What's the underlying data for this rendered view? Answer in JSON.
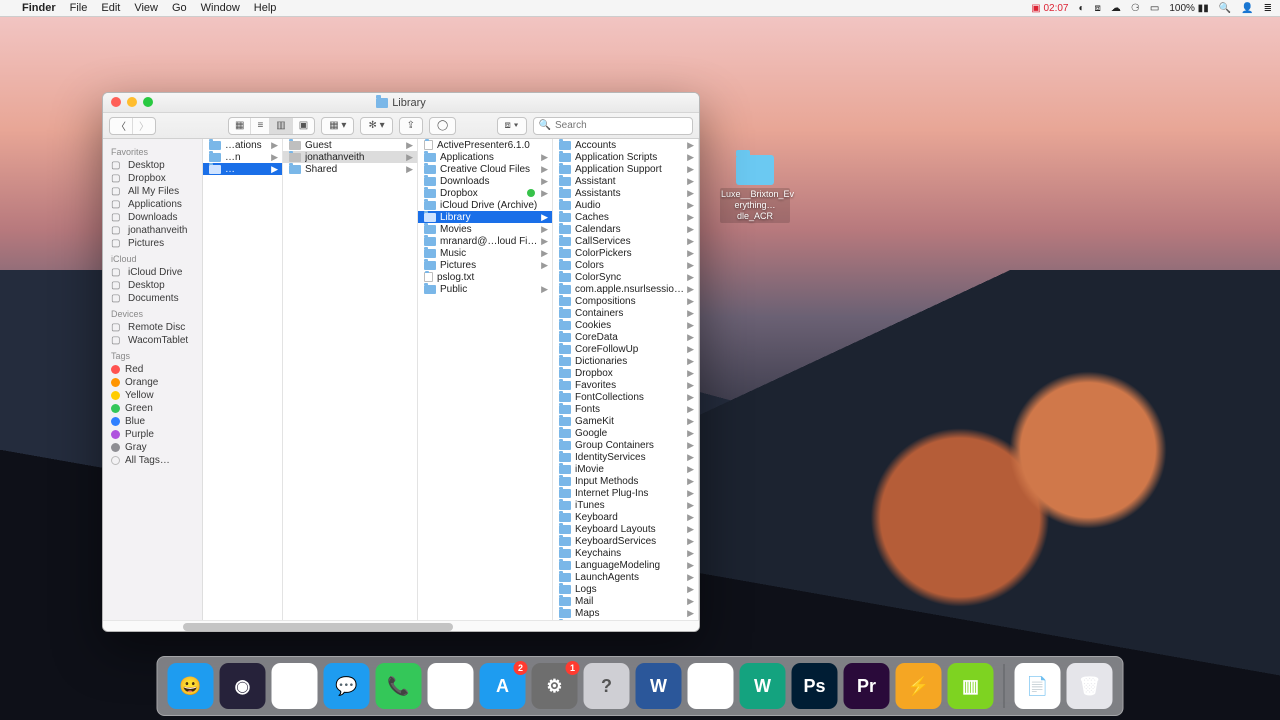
{
  "menubar": {
    "app": "Finder",
    "items": [
      "File",
      "Edit",
      "View",
      "Go",
      "Window",
      "Help"
    ],
    "rec": "02:07",
    "battery": "100%"
  },
  "desktop_icon": {
    "line1": "Luxe__Brixton_Ev",
    "line2": "erything…dle_ACR"
  },
  "window": {
    "title": "Library",
    "search_placeholder": "Search",
    "sidebar": {
      "favorites_head": "Favorites",
      "favorites": [
        "Desktop",
        "Dropbox",
        "All My Files",
        "Applications",
        "Downloads",
        "jonathanveith",
        "Pictures"
      ],
      "icloud_head": "iCloud",
      "icloud": [
        "iCloud Drive",
        "Desktop",
        "Documents"
      ],
      "devices_head": "Devices",
      "devices": [
        "Remote Disc",
        "WacomTablet"
      ],
      "tags_head": "Tags",
      "tags": [
        {
          "label": "Red",
          "c": "#ff5350"
        },
        {
          "label": "Orange",
          "c": "#ff9500"
        },
        {
          "label": "Yellow",
          "c": "#ffcc00"
        },
        {
          "label": "Green",
          "c": "#34c759"
        },
        {
          "label": "Blue",
          "c": "#2f80ff"
        },
        {
          "label": "Purple",
          "c": "#af52de"
        },
        {
          "label": "Gray",
          "c": "#8e8e93"
        },
        {
          "label": "All Tags…",
          "c": ""
        }
      ]
    },
    "col0": [
      {
        "n": "…ations",
        "arr": true
      },
      {
        "n": "…n",
        "arr": true
      },
      {
        "n": "…",
        "arr": true,
        "sel": true
      }
    ],
    "col1": [
      {
        "n": "Guest",
        "arr": true,
        "icon": "home"
      },
      {
        "n": "jonathanveith",
        "arr": true,
        "sel": "gray",
        "icon": "home"
      },
      {
        "n": "Shared",
        "arr": true
      }
    ],
    "col2": [
      {
        "n": "ActivePresenter6.1.0",
        "icon": "file"
      },
      {
        "n": "Applications",
        "arr": true
      },
      {
        "n": "Creative Cloud Files",
        "arr": true
      },
      {
        "n": "Downloads",
        "arr": true
      },
      {
        "n": "Dropbox",
        "arr": true,
        "green": true
      },
      {
        "n": "iCloud Drive (Archive)"
      },
      {
        "n": "Library",
        "arr": true,
        "sel": true
      },
      {
        "n": "Movies",
        "arr": true
      },
      {
        "n": "mranard@…loud Files",
        "arr": true
      },
      {
        "n": "Music",
        "arr": true
      },
      {
        "n": "Pictures",
        "arr": true
      },
      {
        "n": "pslog.txt",
        "icon": "file"
      },
      {
        "n": "Public",
        "arr": true
      }
    ],
    "col3": [
      "Accounts",
      "Application Scripts",
      "Application Support",
      "Assistant",
      "Assistants",
      "Audio",
      "Caches",
      "Calendars",
      "CallServices",
      "ColorPickers",
      "Colors",
      "ColorSync",
      "com.apple.nsurlsessiond",
      "Compositions",
      "Containers",
      "Cookies",
      "CoreData",
      "CoreFollowUp",
      "Dictionaries",
      "Dropbox",
      "Favorites",
      "FontCollections",
      "Fonts",
      "GameKit",
      "Google",
      "Group Containers",
      "IdentityServices",
      "iMovie",
      "Input Methods",
      "Internet Plug-Ins",
      "iTunes",
      "Keyboard",
      "Keyboard Layouts",
      "KeyboardServices",
      "Keychains",
      "LanguageModeling",
      "LaunchAgents",
      "Logs",
      "Mail",
      "Maps",
      "Messages"
    ]
  },
  "dock": {
    "apps": [
      {
        "n": "finder",
        "c": "#1e9cf0",
        "t": "😀"
      },
      {
        "n": "siri",
        "c": "#26223a",
        "t": "◉"
      },
      {
        "n": "photos",
        "c": "#ffffff",
        "t": "✿"
      },
      {
        "n": "messages",
        "c": "#1e9cf0",
        "t": "💬"
      },
      {
        "n": "facetime",
        "c": "#34c759",
        "t": "📞"
      },
      {
        "n": "itunes",
        "c": "#ffffff",
        "t": "♫"
      },
      {
        "n": "appstore",
        "c": "#1e9cf0",
        "t": "A",
        "badge": "2"
      },
      {
        "n": "settings",
        "c": "#6e6e6e",
        "t": "⚙",
        "badge": "1"
      },
      {
        "n": "help",
        "c": "#cfcfd4",
        "t": "?",
        "dark": true
      },
      {
        "n": "word",
        "c": "#2b579a",
        "t": "W"
      },
      {
        "n": "chrome",
        "c": "#ffffff",
        "t": "◯"
      },
      {
        "n": "wire",
        "c": "#14a37f",
        "t": "W"
      },
      {
        "n": "photoshop",
        "c": "#001d34",
        "t": "Ps"
      },
      {
        "n": "premiere",
        "c": "#2a0a3a",
        "t": "Pr"
      },
      {
        "n": "cyberduck",
        "c": "#f5a623",
        "t": "⚡"
      },
      {
        "n": "archive",
        "c": "#7ed321",
        "t": "▥"
      }
    ],
    "right": [
      {
        "n": "doc",
        "c": "#ffffff",
        "t": "📄"
      },
      {
        "n": "trash",
        "c": "#e5e5ea",
        "t": "🗑"
      }
    ]
  }
}
